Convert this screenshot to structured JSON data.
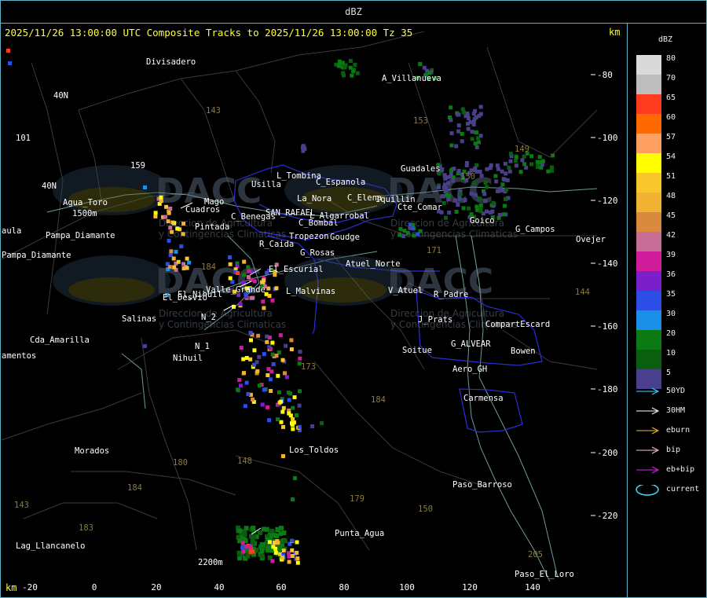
{
  "window": {
    "title": "dBZ"
  },
  "header": {
    "text": "2025/11/26 13:00:00 UTC Composite Tracks to 2025/11/26 13:00:00 Tz 35",
    "km_top": "km",
    "km_bottom": "km"
  },
  "legend": {
    "unit": "dBZ",
    "levels": [
      {
        "value": "80",
        "color": "#d9d9d9"
      },
      {
        "value": "70",
        "color": "#bdbdbd"
      },
      {
        "value": "65",
        "color": "#ff3b1f"
      },
      {
        "value": "60",
        "color": "#ff6a00"
      },
      {
        "value": "57",
        "color": "#ffa060"
      },
      {
        "value": "54",
        "color": "#ffff00"
      },
      {
        "value": "51",
        "color": "#f7c72b"
      },
      {
        "value": "48",
        "color": "#f2b233"
      },
      {
        "value": "45",
        "color": "#d98a3f"
      },
      {
        "value": "42",
        "color": "#c86e96"
      },
      {
        "value": "39",
        "color": "#d01c9a"
      },
      {
        "value": "36",
        "color": "#7a1fc9"
      },
      {
        "value": "35",
        "color": "#2d4ee6"
      },
      {
        "value": "30",
        "color": "#1a8fe8"
      },
      {
        "value": "20",
        "color": "#0a7a12"
      },
      {
        "value": "10",
        "color": "#0b5e10"
      },
      {
        "value": "5",
        "color": "#4a3f8c"
      }
    ],
    "tracks": [
      {
        "label": "50YD",
        "color": "#33e0ff"
      },
      {
        "label": "30HM",
        "color": "#ffffff"
      },
      {
        "label": "eburn",
        "color": "#f5b642"
      },
      {
        "label": "bip",
        "color": "#ffc0d0"
      },
      {
        "label": "eb+bip",
        "color": "#e020e0"
      },
      {
        "label": "current",
        "color": "#33e0ff"
      }
    ]
  },
  "axes": {
    "x_ticks": [
      "-20",
      "0",
      "20",
      "40",
      "60",
      "80",
      "100",
      "120",
      "140"
    ],
    "y_ticks": [
      "-80",
      "-100",
      "-120",
      "-140",
      "-160",
      "-180",
      "-200",
      "-220"
    ]
  },
  "places": [
    "Divisadero",
    "A_Villanueva",
    "40N",
    "101",
    "159",
    "40N",
    "Agua_Toro",
    "1500m",
    "aula",
    "Pampa_Diamante",
    "Pampa_Diamante",
    "Guadales",
    "El_Nihuil",
    "N_2",
    "N_1",
    "Nihuil",
    "Salinas",
    "Cda_Amarilla",
    "amentos",
    "Morados",
    "Los_Toldos",
    "Punta_Agua",
    "Lag_Llancanelo",
    "2200m",
    "Paso_Barroso",
    "Paso_El_Loro",
    "Carmensa",
    "Aero_GH",
    "Bowen",
    "G_ALVEAR",
    "CompartEscard",
    "J_Prats",
    "R_Padre",
    "V_Atuel",
    "Soitue",
    "Atuel_Norte",
    "El_Escurial",
    "L_Malvinas",
    "Valle_Grande",
    "El_Desvio",
    "R_Caida",
    "G_Rosas",
    "Tropezon",
    "Goudge",
    "C_Bombal",
    "L_Algarrobal",
    "SAN_RAFAEL",
    "C_Benegas",
    "Usilla",
    "Pintada",
    "Cuadros",
    "Mago",
    "La_Nora",
    "C_Espanola",
    "L_Tombina",
    "C_Elena",
    "Iquillin",
    "Cte_Comar",
    "Goico",
    "G_Campos",
    "Ovejer",
    "143",
    "153",
    "171",
    "173",
    "184",
    "180",
    "179",
    "150",
    "183",
    "184",
    "143",
    "205",
    "144",
    "184",
    "148",
    "149",
    "150"
  ],
  "watermark": {
    "brand": "DACC",
    "line1": "Direccion de Agricultura",
    "line2": "y Contingencias Climaticas"
  }
}
